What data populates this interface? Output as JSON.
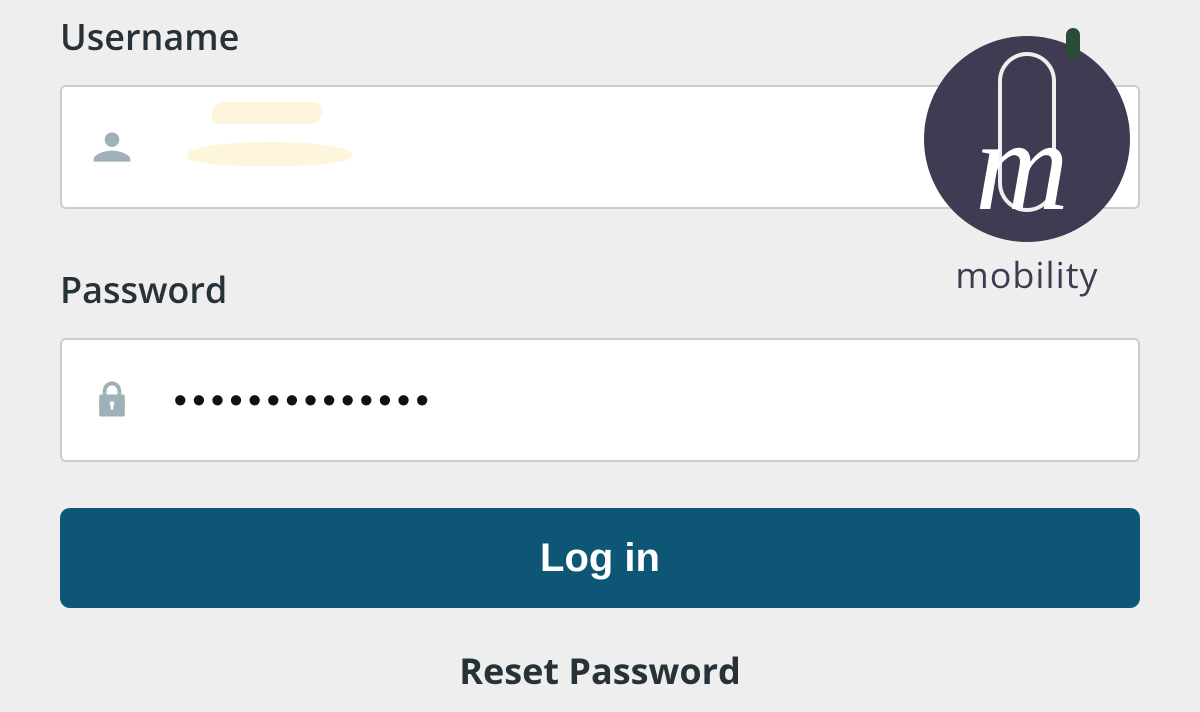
{
  "form": {
    "username_label": "Username",
    "username_value": "",
    "password_label": "Password",
    "password_value": "••••••••••••••",
    "login_button_label": "Log in",
    "reset_password_label": "Reset Password"
  },
  "logo": {
    "brand_text": "mobility"
  },
  "colors": {
    "button_bg": "#0e5675",
    "icon_fill": "#9eb0b8",
    "logo_fill": "#403a52"
  }
}
